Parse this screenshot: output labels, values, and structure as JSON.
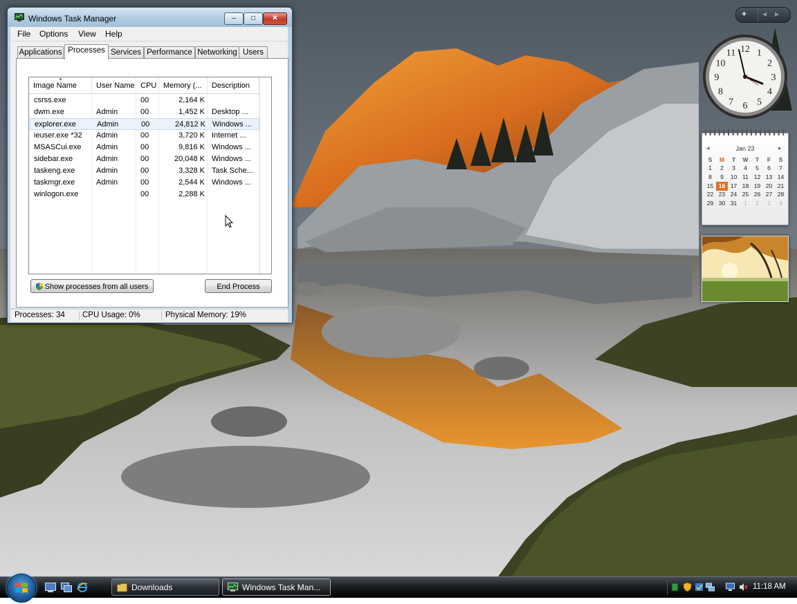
{
  "window": {
    "title": "Windows Task Manager",
    "min_label": "–",
    "max_label": "□",
    "close_label": "✕"
  },
  "menu": [
    "File",
    "Options",
    "View",
    "Help"
  ],
  "tabs": [
    "Applications",
    "Processes",
    "Services",
    "Performance",
    "Networking",
    "Users"
  ],
  "active_tab": "Processes",
  "columns": [
    "Image Name",
    "User Name",
    "CPU",
    "Memory (...",
    "Description"
  ],
  "processes": [
    {
      "image": "csrss.exe",
      "user": "",
      "cpu": "00",
      "memory": "2,164 K",
      "description": ""
    },
    {
      "image": "dwm.exe",
      "user": "Admin",
      "cpu": "00",
      "memory": "1,452 K",
      "description": "Desktop ..."
    },
    {
      "image": "explorer.exe",
      "user": "Admin",
      "cpu": "00",
      "memory": "24,812 K",
      "description": "Windows ..."
    },
    {
      "image": "ieuser.exe *32",
      "user": "Admin",
      "cpu": "00",
      "memory": "3,720 K",
      "description": "Internet ..."
    },
    {
      "image": "MSASCui.exe",
      "user": "Admin",
      "cpu": "00",
      "memory": "9,816 K",
      "description": "Windows ..."
    },
    {
      "image": "sidebar.exe",
      "user": "Admin",
      "cpu": "00",
      "memory": "20,048 K",
      "description": "Windows ..."
    },
    {
      "image": "taskeng.exe",
      "user": "Admin",
      "cpu": "00",
      "memory": "3,328 K",
      "description": "Task Sche..."
    },
    {
      "image": "taskmgr.exe",
      "user": "Admin",
      "cpu": "00",
      "memory": "2,544 K",
      "description": "Windows ..."
    },
    {
      "image": "winlogon.exe",
      "user": "",
      "cpu": "00",
      "memory": "2,288 K",
      "description": ""
    }
  ],
  "selected_process": "explorer.exe",
  "buttons": {
    "show_all": "Show processes from all users",
    "end_process": "End Process"
  },
  "status": {
    "processes": "Processes: 34",
    "cpu": "CPU Usage: 0%",
    "memory": "Physical Memory: 19%"
  },
  "sidebar": {
    "add_label": "+",
    "prev_label": "◂",
    "next_label": "▸",
    "clock_numbers": [
      "12",
      "1",
      "2",
      "3",
      "4",
      "5",
      "6",
      "7",
      "8",
      "9",
      "10",
      "11"
    ],
    "calendar": {
      "month": "Jan 23",
      "prev": "◂",
      "next": "▸",
      "weekdays": [
        "S",
        "M",
        "T",
        "W",
        "T",
        "F",
        "S"
      ],
      "days": [
        "",
        "",
        "",
        "",
        "",
        "",
        "",
        "1",
        "2",
        "3",
        "4",
        "5",
        "6",
        "7",
        "8",
        "9",
        "10",
        "11",
        "12",
        "13",
        "14",
        "15",
        "16",
        "17",
        "18",
        "19",
        "20",
        "21",
        "22",
        "23",
        "24",
        "25",
        "26",
        "27",
        "28",
        "29",
        "30",
        "31",
        "1",
        "2",
        "3",
        "4"
      ],
      "today": "16"
    }
  },
  "taskbar": {
    "buttons": [
      "Downloads",
      "Windows Task Man..."
    ],
    "active": "Windows Task Man...",
    "time": "11:18 AM"
  },
  "colors": {
    "window_frame": "#bcd4e6",
    "selection": "#eaf3fb",
    "today": "#e0722a",
    "taskbar": "#1b1f23"
  }
}
